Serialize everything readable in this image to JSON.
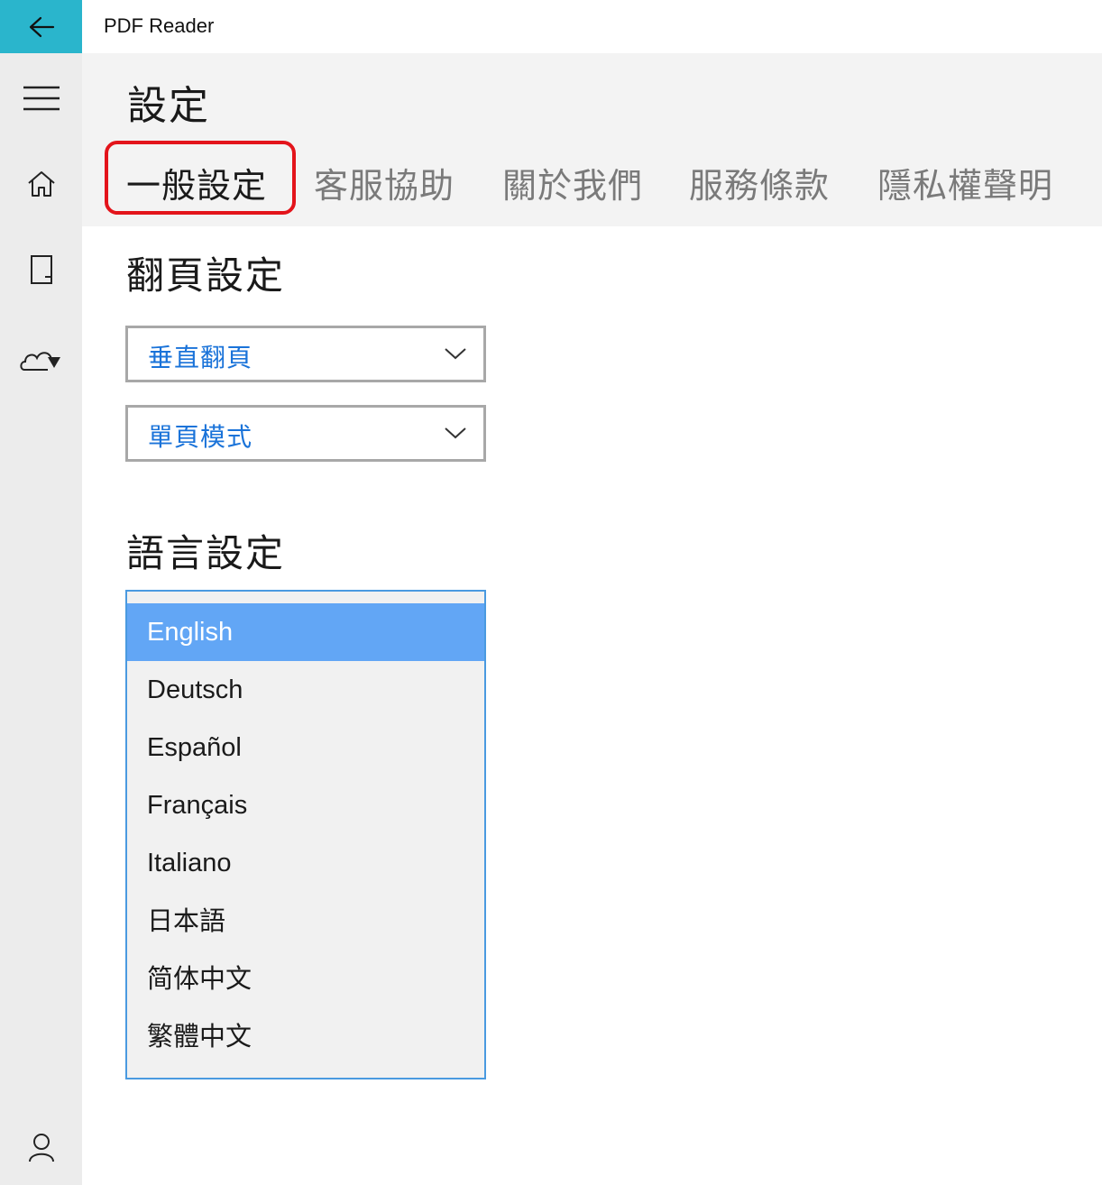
{
  "window": {
    "title": "PDF Reader"
  },
  "nav": {
    "back_icon": "arrow-left-icon",
    "items": [
      {
        "icon": "hamburger-menu-icon"
      },
      {
        "icon": "home-icon"
      },
      {
        "icon": "document-icon"
      },
      {
        "icon": "cloud-download-icon"
      },
      {
        "icon": "user-icon"
      }
    ]
  },
  "header": {
    "title": "設定",
    "tabs": [
      {
        "label": "一般設定",
        "active": true
      },
      {
        "label": "客服協助",
        "active": false
      },
      {
        "label": "關於我們",
        "active": false
      },
      {
        "label": "服務條款",
        "active": false
      },
      {
        "label": "隱私權聲明",
        "active": false
      }
    ]
  },
  "page_turn": {
    "title": "翻頁設定",
    "direction_select": {
      "value": "垂直翻頁"
    },
    "mode_select": {
      "value": "單頁模式"
    }
  },
  "language": {
    "title": "語言設定",
    "options": [
      {
        "label": "English",
        "selected": true
      },
      {
        "label": "Deutsch",
        "selected": false
      },
      {
        "label": "Español",
        "selected": false
      },
      {
        "label": "Français",
        "selected": false
      },
      {
        "label": "Italiano",
        "selected": false
      },
      {
        "label": "日本語",
        "selected": false
      },
      {
        "label": "简体中文",
        "selected": false
      },
      {
        "label": "繁體中文",
        "selected": false
      }
    ]
  },
  "colors": {
    "accent": "#2ab5cc",
    "selected_item": "#62a6f5",
    "link_text": "#1a73d9",
    "highlight_ring": "#e3141b"
  }
}
